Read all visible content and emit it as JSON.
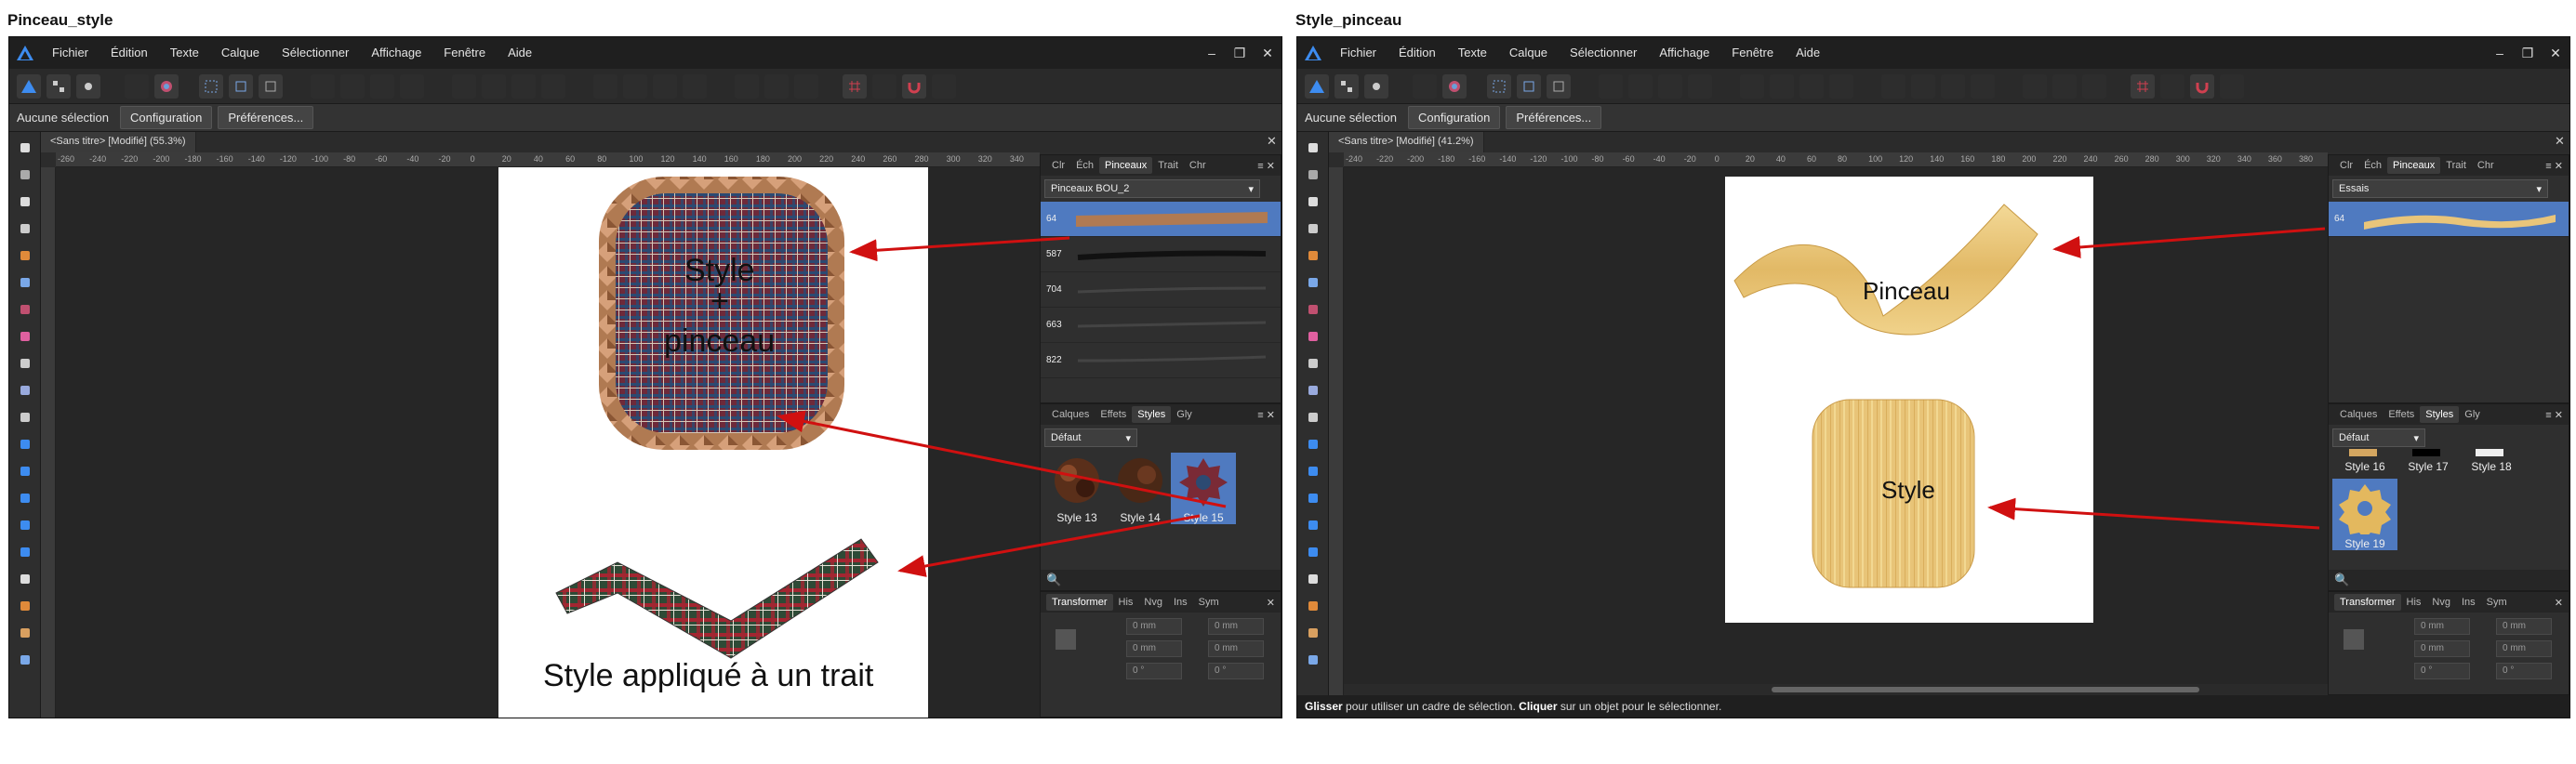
{
  "left": {
    "title": "Pinceau_style",
    "menus": [
      "Fichier",
      "Édition",
      "Texte",
      "Calque",
      "Sélectionner",
      "Affichage",
      "Fenêtre",
      "Aide"
    ],
    "context": {
      "selection": "Aucune sélection",
      "config": "Configuration",
      "prefs": "Préférences..."
    },
    "doc_tab": "<Sans titre> [Modifié] (55.3%)",
    "ruler_ticks": [
      "-260",
      "-240",
      "-220",
      "-200",
      "-180",
      "-160",
      "-140",
      "-120",
      "-100",
      "-80",
      "-60",
      "-40",
      "-20",
      "0",
      "20",
      "40",
      "60",
      "80",
      "100",
      "120",
      "140",
      "160",
      "180",
      "200",
      "220",
      "240",
      "260",
      "280",
      "300",
      "320",
      "340"
    ],
    "brush_tabs": [
      "Clr",
      "Éch",
      "Pinceaux",
      "Trait",
      "Chr"
    ],
    "brush_category": "Pinceaux BOU_2",
    "brushes": [
      "64",
      "587",
      "704",
      "663",
      "822"
    ],
    "style_tabs": [
      "Calques",
      "Effets",
      "Styles",
      "Gly"
    ],
    "style_category": "Défaut",
    "styles": [
      "Style 13",
      "Style 14",
      "Style 15"
    ],
    "transform_tabs": [
      "Transformer",
      "His",
      "Nvg",
      "Ins",
      "Sym"
    ],
    "fields": [
      "0 mm",
      "0 mm",
      "0 mm",
      "0 mm",
      "0 °",
      "0 °"
    ],
    "canvas_text": {
      "style": "Style",
      "plus": "+",
      "pinceau": "pinceau",
      "caption": "Style appliqué à un trait"
    }
  },
  "right": {
    "title": "Style_pinceau",
    "menus": [
      "Fichier",
      "Édition",
      "Texte",
      "Calque",
      "Sélectionner",
      "Affichage",
      "Fenêtre",
      "Aide"
    ],
    "context": {
      "selection": "Aucune sélection",
      "config": "Configuration",
      "prefs": "Préférences..."
    },
    "doc_tab": "<Sans titre> [Modifié] (41.2%)",
    "ruler_ticks": [
      "-240",
      "-220",
      "-200",
      "-180",
      "-160",
      "-140",
      "-120",
      "-100",
      "-80",
      "-60",
      "-40",
      "-20",
      "0",
      "20",
      "40",
      "60",
      "80",
      "100",
      "120",
      "140",
      "160",
      "180",
      "200",
      "220",
      "240",
      "260",
      "280",
      "300",
      "320",
      "340",
      "360",
      "380"
    ],
    "brush_tabs": [
      "Clr",
      "Éch",
      "Pinceaux",
      "Trait",
      "Chr"
    ],
    "brush_category": "Essais",
    "brushes": [
      "64"
    ],
    "style_tabs": [
      "Calques",
      "Effets",
      "Styles",
      "Gly"
    ],
    "style_category": "Défaut",
    "styles": [
      "Style 16",
      "Style 17",
      "Style 18",
      "Style 19"
    ],
    "transform_tabs": [
      "Transformer",
      "His",
      "Nvg",
      "Ins",
      "Sym"
    ],
    "fields": [
      "0 mm",
      "0 mm",
      "0 mm",
      "0 mm",
      "0 °",
      "0 °"
    ],
    "canvas_text": {
      "pinceau": "Pinceau",
      "style": "Style"
    },
    "status": {
      "drag": "Glisser",
      "drag_rest": " pour utiliser un cadre de sélection. ",
      "click": "Cliquer",
      "click_rest": " sur un objet pour le sélectionner."
    }
  },
  "colors": {
    "accent": "#4f7ac0",
    "arrow": "#d01010",
    "wood": "#e6c06a",
    "plaid": "#7a2a36"
  }
}
